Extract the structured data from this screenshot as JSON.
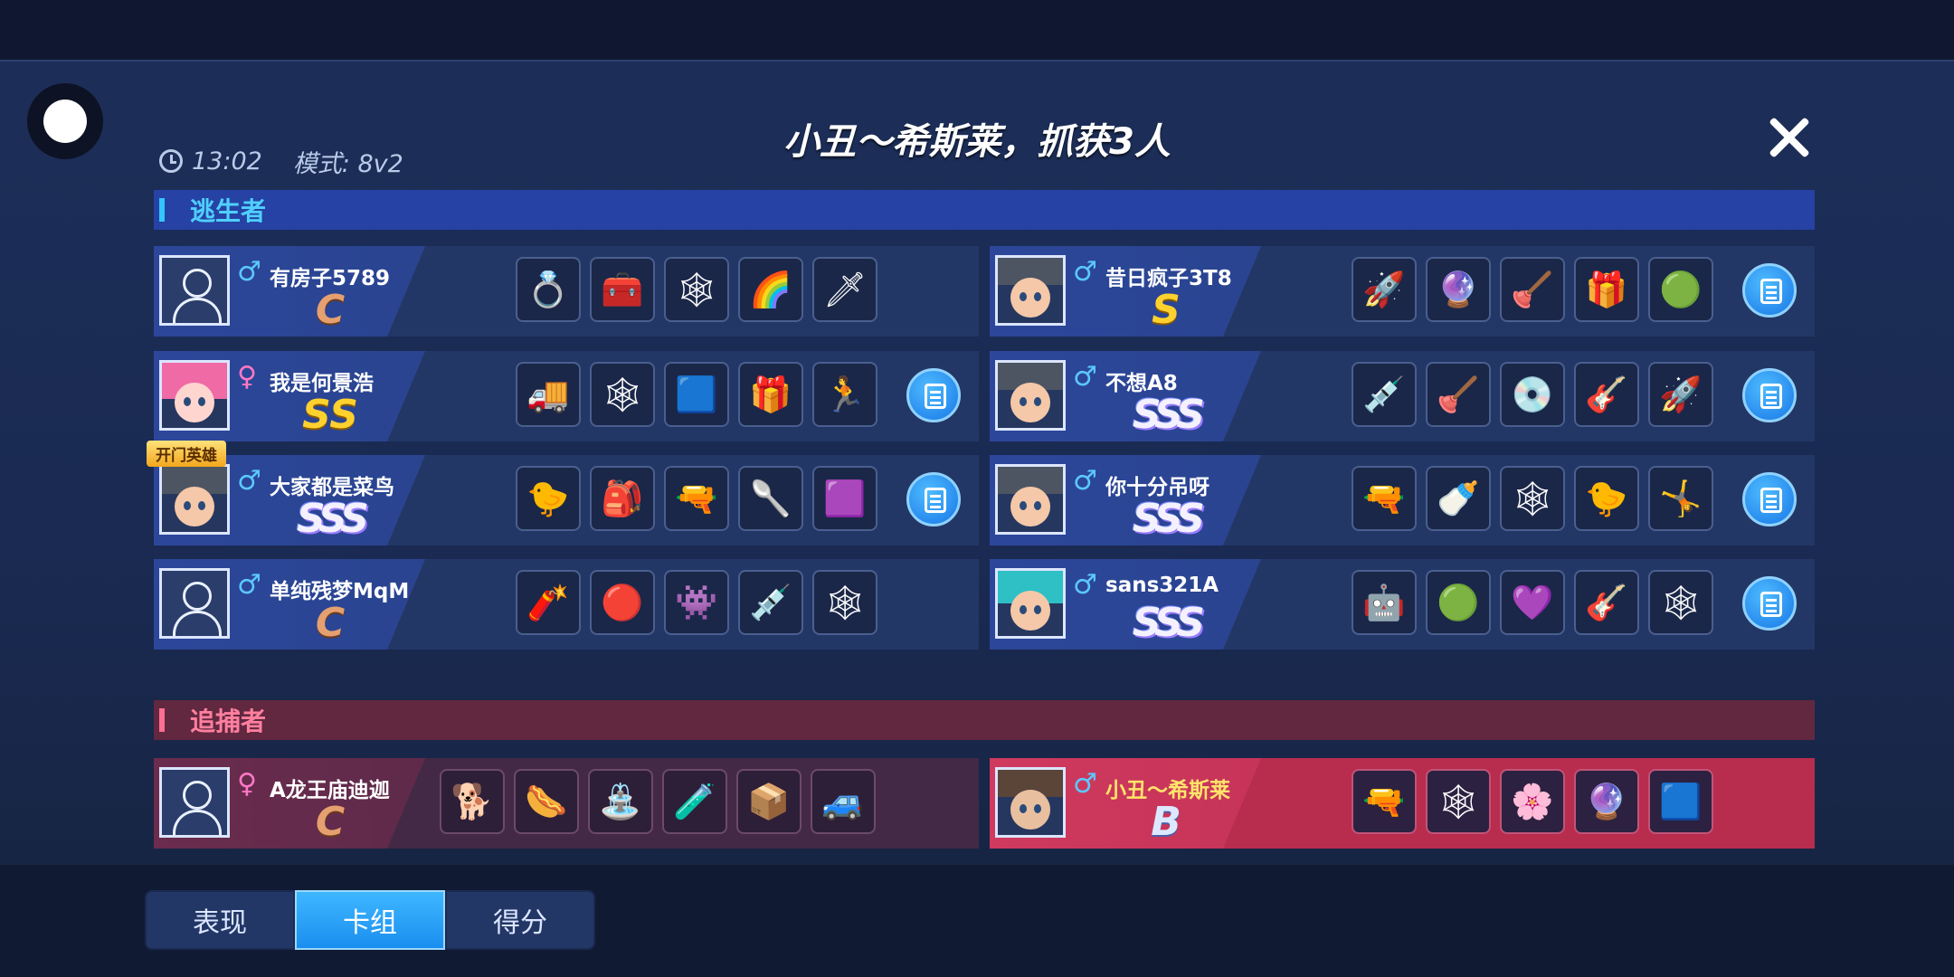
{
  "header": {
    "time": "13:02",
    "mode": "模式: 8v2",
    "title": "小丑～希斯莱，抓获3人"
  },
  "sections": {
    "escapers": "逃生者",
    "hunters": "追捕者"
  },
  "hero_tag": "开门英雄",
  "players": {
    "e1": {
      "name": "有房子5789",
      "gender": "♂",
      "grade": "C",
      "cards": [
        {
          "icon": "gold-ring",
          "g": "💍"
        },
        {
          "icon": "treasure-chest",
          "g": "🧰"
        },
        {
          "icon": "spider-web",
          "g": "🕸"
        },
        {
          "icon": "rainbow-cake",
          "g": "🌈"
        },
        {
          "icon": "blue-sword",
          "g": "🗡"
        }
      ]
    },
    "e2": {
      "name": "昔日疯子3T8",
      "gender": "♂",
      "grade": "S",
      "cards": [
        {
          "icon": "rocket",
          "g": "🚀"
        },
        {
          "icon": "crystal-ball",
          "g": "🔮"
        },
        {
          "icon": "plunger",
          "g": "🪠"
        },
        {
          "icon": "red-box",
          "g": "🎁"
        },
        {
          "icon": "green-pool",
          "g": "🟢"
        }
      ]
    },
    "e3": {
      "name": "我是何景浩",
      "gender": "♀",
      "grade": "SS",
      "cards": [
        {
          "icon": "blue-truck",
          "g": "🚚"
        },
        {
          "icon": "spider-web",
          "g": "🕸"
        },
        {
          "icon": "blue-screen",
          "g": "🟦"
        },
        {
          "icon": "red-box",
          "g": "🎁"
        },
        {
          "icon": "running-man",
          "g": "🏃"
        }
      ]
    },
    "e4": {
      "name": "不想A8",
      "gender": "♂",
      "grade": "SSS",
      "cards": [
        {
          "icon": "syringe",
          "g": "💉"
        },
        {
          "icon": "plunger",
          "g": "🪠"
        },
        {
          "icon": "silver-ring",
          "g": "💿"
        },
        {
          "icon": "guitar",
          "g": "🎸"
        },
        {
          "icon": "rocket",
          "g": "🚀"
        }
      ]
    },
    "e5": {
      "name": "大家都是菜鸟",
      "gender": "♂",
      "grade": "SSS",
      "cards": [
        {
          "icon": "duck-helmet",
          "g": "🐤"
        },
        {
          "icon": "green-box",
          "g": "🎒"
        },
        {
          "icon": "blue-cannon",
          "g": "🔫"
        },
        {
          "icon": "pink-ladle",
          "g": "🥄"
        },
        {
          "icon": "purple-box",
          "g": "🟪"
        }
      ]
    },
    "e6": {
      "name": "你十分吊呀",
      "gender": "♂",
      "grade": "SSS",
      "cards": [
        {
          "icon": "blue-cannon",
          "g": "🔫"
        },
        {
          "icon": "baby-bottle",
          "g": "🍼"
        },
        {
          "icon": "spider-web",
          "g": "🕸"
        },
        {
          "icon": "duck-helmet",
          "g": "🐤"
        },
        {
          "icon": "jumping-man",
          "g": "🤸"
        }
      ]
    },
    "e7": {
      "name": "单纯残梦MqM",
      "gender": "♂",
      "grade": "C",
      "cards": [
        {
          "icon": "bazooka",
          "g": "🧨"
        },
        {
          "icon": "red-orb",
          "g": "🔴"
        },
        {
          "icon": "green-mask",
          "g": "👾"
        },
        {
          "icon": "syringe",
          "g": "💉"
        },
        {
          "icon": "spider-web",
          "g": "🕸"
        }
      ]
    },
    "e8": {
      "name": "sans321A",
      "gender": "♂",
      "grade": "SSS",
      "cards": [
        {
          "icon": "robot",
          "g": "🤖"
        },
        {
          "icon": "green-pool",
          "g": "🟢"
        },
        {
          "icon": "purple-cannon",
          "g": "💜"
        },
        {
          "icon": "guitar",
          "g": "🎸"
        },
        {
          "icon": "spider-web",
          "g": "🕸"
        }
      ]
    },
    "h1": {
      "name": "A龙王庙迪迦",
      "gender": "♀",
      "grade": "C",
      "cards": [
        {
          "icon": "gold-dog",
          "g": "🐕"
        },
        {
          "icon": "hot-dog",
          "g": "🌭"
        },
        {
          "icon": "water-fountain",
          "g": "⛲"
        },
        {
          "icon": "purple-potion",
          "g": "🧪"
        },
        {
          "icon": "gray-cube",
          "g": "📦"
        },
        {
          "icon": "white-vehicle",
          "g": "🚙"
        }
      ]
    },
    "h2": {
      "name": "小丑～希斯莱",
      "gender": "♂",
      "grade": "B",
      "cards": [
        {
          "icon": "blue-cannon",
          "g": "🔫"
        },
        {
          "icon": "spider-web",
          "g": "🕸"
        },
        {
          "icon": "pink-flower",
          "g": "🌸"
        },
        {
          "icon": "crystal-ball",
          "g": "🔮"
        },
        {
          "icon": "blue-screen",
          "g": "🟦"
        }
      ]
    }
  },
  "tabs": [
    "表现",
    "卡组",
    "得分"
  ],
  "active_tab": "卡组"
}
